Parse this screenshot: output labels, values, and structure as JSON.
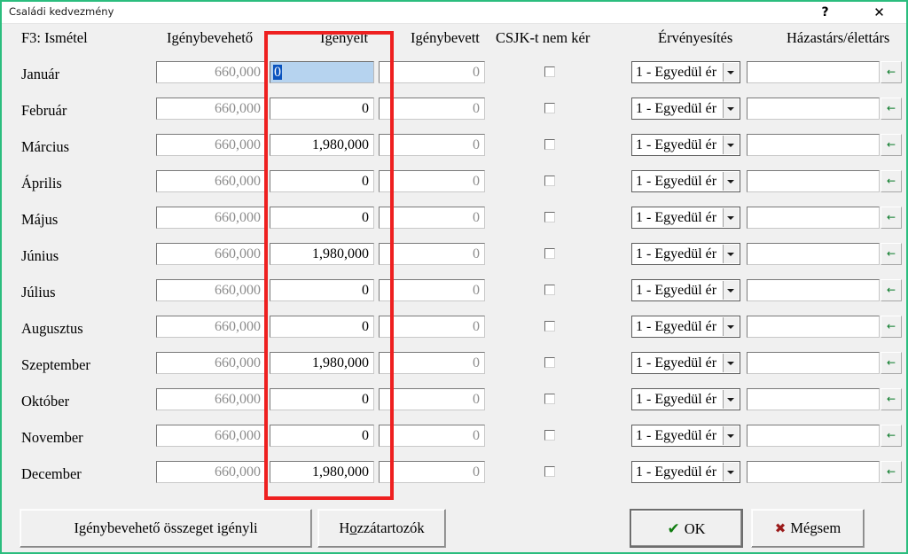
{
  "window": {
    "title": "Családi kedvezmény",
    "help_label": "?",
    "close_label": "✕",
    "border_color": "#2bbd7e"
  },
  "headers": {
    "repeat_hint": "F3: Ismétel",
    "available": "Igénybevehető",
    "claimed": "Igényelt",
    "used": "Igénybevett",
    "no_csjk": "CSJK-t nem kér",
    "validation": "Érvényesítés",
    "spouse": "Házastárs/élettárs"
  },
  "row_defaults": {
    "validation_option": "1 - Egyedül ér",
    "spouse_value": "",
    "arrow_icon": "←",
    "checkbox_checked": false
  },
  "rows": [
    {
      "month": "Január",
      "available": "660,000",
      "claimed": "0",
      "used": "0"
    },
    {
      "month": "Február",
      "available": "660,000",
      "claimed": "0",
      "used": "0"
    },
    {
      "month": "Március",
      "available": "660,000",
      "claimed": "1,980,000",
      "used": "0"
    },
    {
      "month": "Április",
      "available": "660,000",
      "claimed": "0",
      "used": "0"
    },
    {
      "month": "Május",
      "available": "660,000",
      "claimed": "0",
      "used": "0"
    },
    {
      "month": "Június",
      "available": "660,000",
      "claimed": "1,980,000",
      "used": "0"
    },
    {
      "month": "Július",
      "available": "660,000",
      "claimed": "0",
      "used": "0"
    },
    {
      "month": "Augusztus",
      "available": "660,000",
      "claimed": "0",
      "used": "0"
    },
    {
      "month": "Szeptember",
      "available": "660,000",
      "claimed": "1,980,000",
      "used": "0"
    },
    {
      "month": "Október",
      "available": "660,000",
      "claimed": "0",
      "used": "0"
    },
    {
      "month": "November",
      "available": "660,000",
      "claimed": "0",
      "used": "0"
    },
    {
      "month": "December",
      "available": "660,000",
      "claimed": "1,980,000",
      "used": "0"
    }
  ],
  "focus": {
    "row_index": 0,
    "column": "claimed",
    "selected_text": "0",
    "selection_color": "#0a53be",
    "field_color": "#b6d3ef"
  },
  "buttons": {
    "claim_all": "Igénybevehető összeget igényli",
    "relatives_prefix": "H",
    "relatives_accel": "o",
    "relatives_suffix": "zzátartozók",
    "ok": "OK",
    "cancel": "Mégsem",
    "ok_icon": "✔",
    "cancel_icon": "✖"
  },
  "annotation": {
    "shape": "rectangle",
    "color": "#ee2020",
    "target_column": "Igényelt"
  }
}
